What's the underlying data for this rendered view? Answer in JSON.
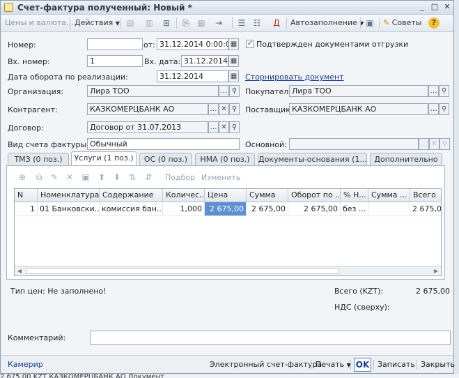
{
  "window": {
    "title": "Счет-фактура полученный: Новый *",
    "controls": {
      "minimize": "_",
      "maximize": "□",
      "close": "✕"
    }
  },
  "toolbar": {
    "prices_label": "Цены и валюта...",
    "actions_label": "Действия",
    "autofill_label": "Автозаполнение",
    "tips_label": "Советы",
    "help_glyph": "?"
  },
  "header": {
    "number_label": "Номер:",
    "number_value": "",
    "from_label": "от:",
    "date_value": "31.12.2014  0:00:00",
    "confirmed_label": "Подтвержден документами отгрузки",
    "confirmed_checked": true,
    "in_number_label": "Вх. номер:",
    "in_number_value": "1",
    "in_date_label": "Вх. дата:",
    "in_date_value": "31.12.2014",
    "turnover_label": "Дата оборота по реализации:",
    "turnover_value": "31.12.2014",
    "storno_link": "Сторнировать документ",
    "org_label": "Организация:",
    "org_value": "Лира ТОО",
    "buyer_label": "Покупатель:",
    "buyer_value": "Лира ТОО",
    "contractor_label": "Контрагент:",
    "contractor_value": "КАЗКОМЕРЦБАНК АО",
    "supplier_label": "Поставщик:",
    "supplier_value": "КАЗКОМЕРЦБАНК АО",
    "contract_label": "Договор:",
    "contract_value": "Договор от 31.07.2013",
    "invoice_type_label": "Вид счета фактуры:",
    "invoice_type_value": "Обычный",
    "basis_label": "Основной:",
    "basis_value": ""
  },
  "tabs": [
    {
      "label": "ТМЗ (0 поз.)",
      "active": false
    },
    {
      "label": "Услуги (1 поз.)",
      "active": true
    },
    {
      "label": "ОС (0 поз.)",
      "active": false
    },
    {
      "label": "НМА (0 поз.)",
      "active": false
    },
    {
      "label": "Документы-основания (1...",
      "active": false
    },
    {
      "label": "Дополнительно",
      "active": false
    }
  ],
  "grid_toolbar": {
    "pick_label": "Подбор",
    "edit_label": "Изменить"
  },
  "table": {
    "columns": [
      "N",
      "Номенклатура",
      "Содержание",
      "Количес...",
      "Цена",
      "Сумма",
      "Оборот по ...",
      "% Н...",
      "Сумма ...",
      "Всего"
    ],
    "rows": [
      [
        "1",
        "01 Банковски...",
        "комиссия бан...",
        "1,000",
        "2 675,00",
        "2 675,00",
        "2 675,00",
        "без ...",
        "",
        "2 675,0"
      ]
    ]
  },
  "footer": {
    "price_type": "Тип цен: Не заполнено!",
    "total_label": "Всего (KZT):",
    "total_value": "2 675,00",
    "vat_label": "НДС (сверху):",
    "vat_value": "",
    "comment_label": "Комментарий:",
    "comment_value": ""
  },
  "bottom": {
    "author_link": "Камерир",
    "einvoice_label": "Электронный счет-фактура",
    "print_label": "Печать",
    "ok_label": "OK",
    "save_label": "Записать",
    "close_label": "Закрыть"
  },
  "behind_row": "2 675,00   KZT   КАЗКОМЕРЦБАНК АО   Документ"
}
